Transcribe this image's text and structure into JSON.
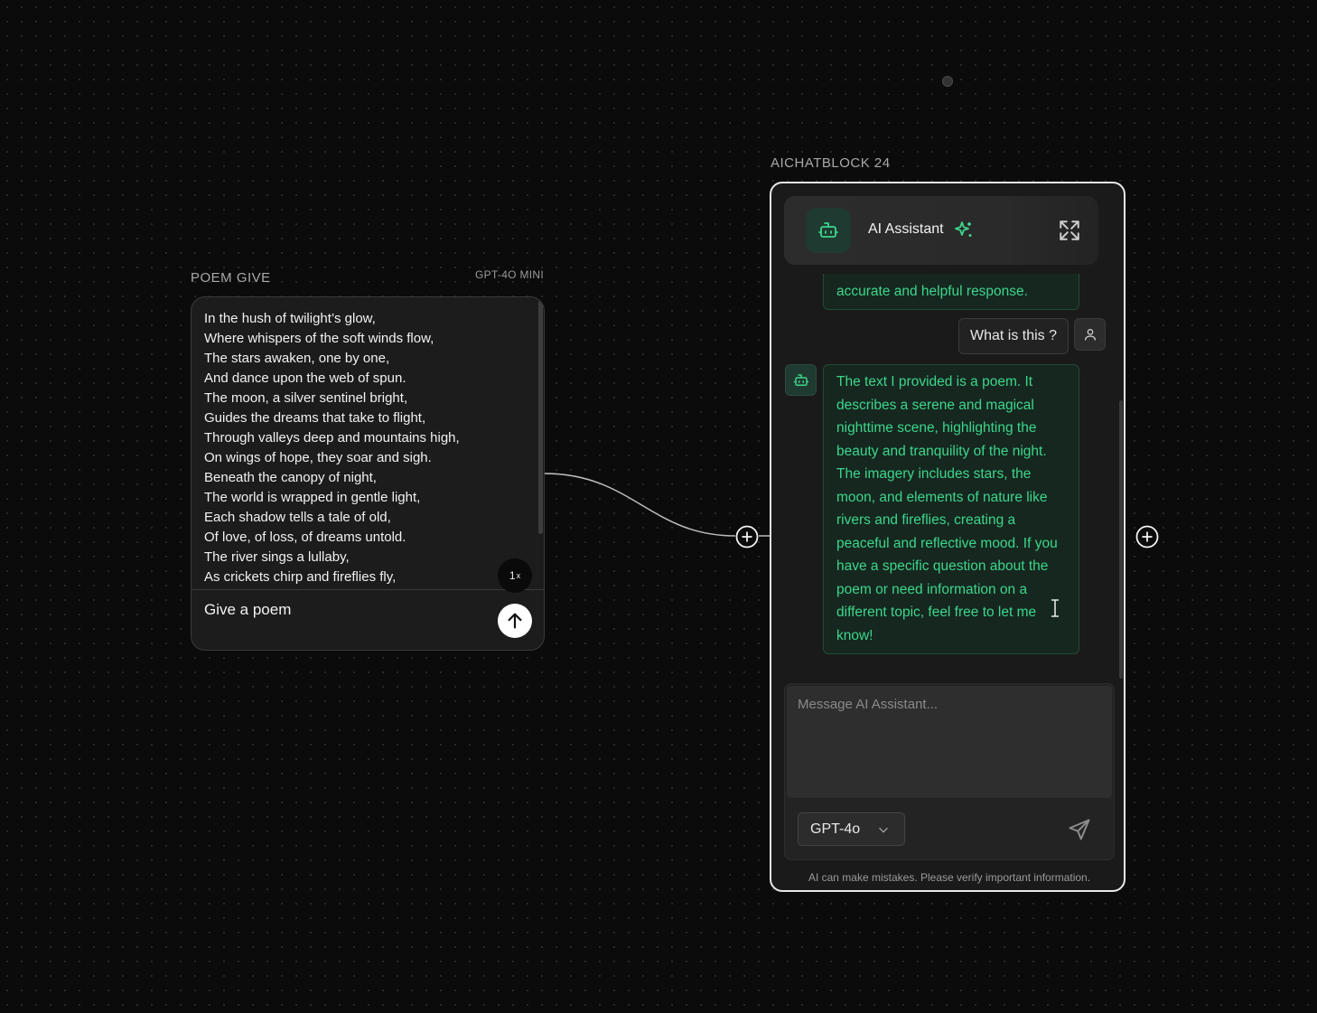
{
  "poem_node": {
    "title": "POEM GIVE",
    "model": "GPT-4O MINI",
    "output_lines": [
      "In the hush of twilight’s glow,",
      "Where whispers of the soft winds flow,",
      "The stars awaken, one by one,",
      "And dance upon the web of spun.",
      "The moon, a silver sentinel bright,",
      "Guides the dreams that take to flight,",
      "Through valleys deep and mountains high,",
      "On wings of hope, they soar and sigh.",
      "Beneath the canopy of night,",
      "The world is wrapped in gentle light,",
      "Each shadow tells a tale of old,",
      "Of love, of loss, of dreams untold.",
      "The river sings a lullaby,",
      "As crickets chirp and fireflies fly,"
    ],
    "speed_value": "1",
    "speed_unit": "x",
    "input_text": "Give a poem"
  },
  "chat_node": {
    "title": "AICHATBLOCK 24",
    "header_title": "AI Assistant",
    "messages": {
      "partial_bot": "accurate and helpful response.",
      "user": "What is this ?",
      "bot": "The text I provided is a poem. It describes a serene and magical nighttime scene, highlighting the beauty and tranquility of the night. The imagery includes stars, the moon, and elements of nature like rivers and fireflies, creating a peaceful and reflective mood. If you have a specific question about the poem or need information on a different topic, feel free to let me know!"
    },
    "composer_placeholder": "Message AI Assistant...",
    "model_selected": "GPT-4o",
    "disclaimer": "AI can make mistakes. Please verify important information."
  },
  "colors": {
    "accent_green": "#3dd68c",
    "bot_bubble_bg": "#16271f",
    "canvas_bg": "#0b0b0b"
  },
  "icons": [
    "bot-icon",
    "sparkle-icon",
    "expand-icon",
    "user-icon",
    "chevron-down-icon",
    "send-icon",
    "arrow-up-icon",
    "plus-circle-icon",
    "text-cursor-icon"
  ]
}
